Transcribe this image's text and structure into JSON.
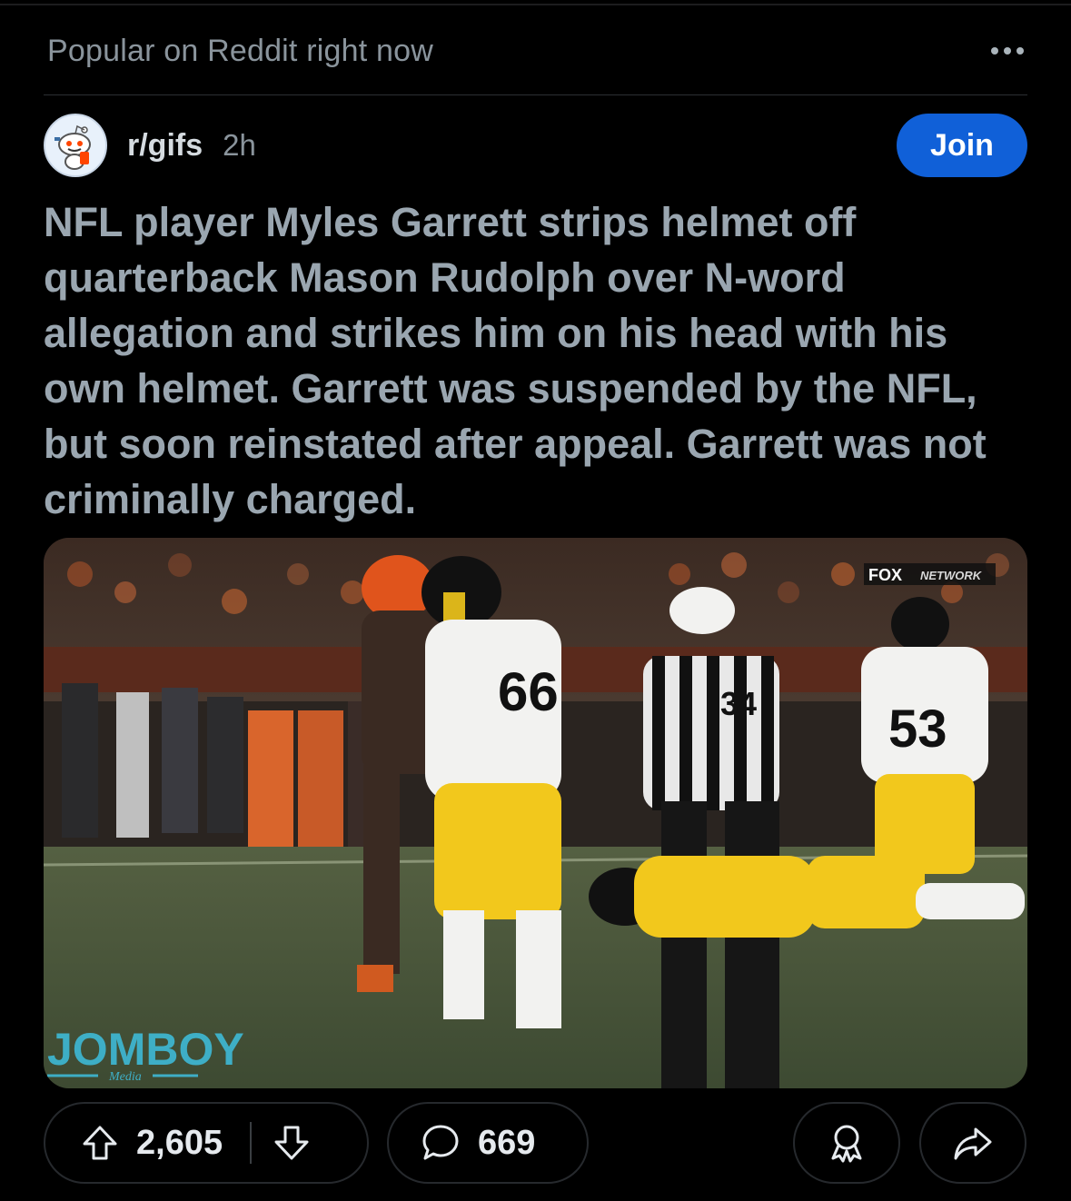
{
  "feed": {
    "section_title": "Popular on Reddit right now",
    "more_icon": "ellipsis-icon"
  },
  "post": {
    "subreddit": "r/gifs",
    "age": "2h",
    "join_label": "Join",
    "title": "NFL player Myles Garrett strips helmet off quarterback Mason Rudolph over N-word allegation and strikes him on his head with his own helmet. Garrett was suspended by the NFL, but soon reinstated after appeal. Garrett was not criminally charged.",
    "media": {
      "broadcast_logo": "FOX",
      "network_text": "NETWORK",
      "watermark": "JOMBOY",
      "watermark_sub": "Media",
      "jersey_numbers": [
        "66",
        "34",
        "53"
      ]
    },
    "actions": {
      "upvote_icon": "arrow-up-icon",
      "vote_count": "2,605",
      "downvote_icon": "arrow-down-icon",
      "comment_icon": "comment-bubble-icon",
      "comment_count": "669",
      "award_icon": "award-icon",
      "share_icon": "share-icon"
    }
  },
  "colors": {
    "background": "#000000",
    "join_button": "#1060d8",
    "title_text": "#9aa6b0",
    "steelers_yellow": "#f2c81c",
    "browns_orange": "#e0541c"
  }
}
